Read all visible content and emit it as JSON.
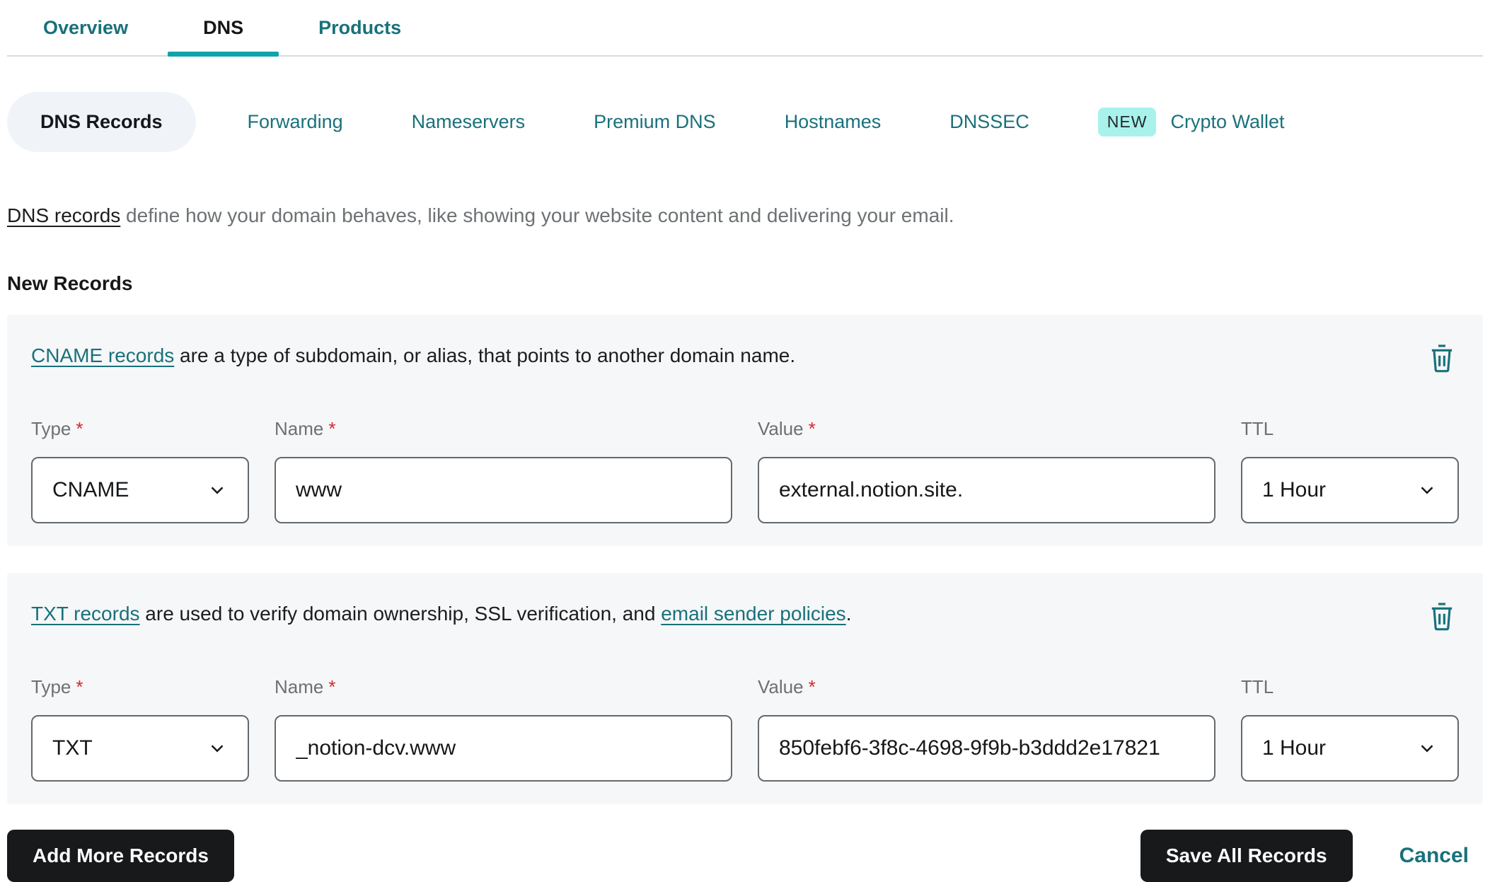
{
  "page_tabs": {
    "overview": "Overview",
    "dns": "DNS",
    "products": "Products"
  },
  "dns_subtabs": {
    "dns_records": "DNS Records",
    "forwarding": "Forwarding",
    "nameservers": "Nameservers",
    "premium_dns": "Premium DNS",
    "hostnames": "Hostnames",
    "dnssec": "DNSSEC",
    "new_badge": "NEW",
    "crypto_wallet": "Crypto Wallet"
  },
  "intro": {
    "link": "DNS records",
    "text": " define how your domain behaves, like showing your website content and delivering your email."
  },
  "section_heading": "New Records",
  "fields": {
    "type": "Type",
    "name": "Name",
    "value": "Value",
    "ttl": "TTL",
    "required_mark": "*"
  },
  "records": [
    {
      "desc_link": "CNAME records",
      "desc_text": " are a type of subdomain, or alias, that points to another domain name.",
      "desc_link2": "",
      "desc_text2": "",
      "type_value": "CNAME",
      "name_value": "www",
      "value_value": "external.notion.site.",
      "ttl_value": "1 Hour"
    },
    {
      "desc_link": "TXT records",
      "desc_text": " are used to verify domain ownership, SSL verification, and ",
      "desc_link2": "email sender policies",
      "desc_text2": ".",
      "type_value": "TXT",
      "name_value": "_notion-dcv.www",
      "value_value": "850febf6-3f8c-4698-9f9b-b3ddd2e17821",
      "ttl_value": "1 Hour"
    }
  ],
  "actions": {
    "add_more": "Add More Records",
    "save_all": "Save All Records",
    "cancel": "Cancel"
  },
  "colors": {
    "teal_link": "#19717b",
    "teal_accent": "#11a3aa",
    "badge_bg": "#a9f2ec",
    "card_bg": "#f5f7f8",
    "pill_bg": "#f0f4f9",
    "button_bg": "#17191b",
    "required_red": "#d9232e"
  }
}
